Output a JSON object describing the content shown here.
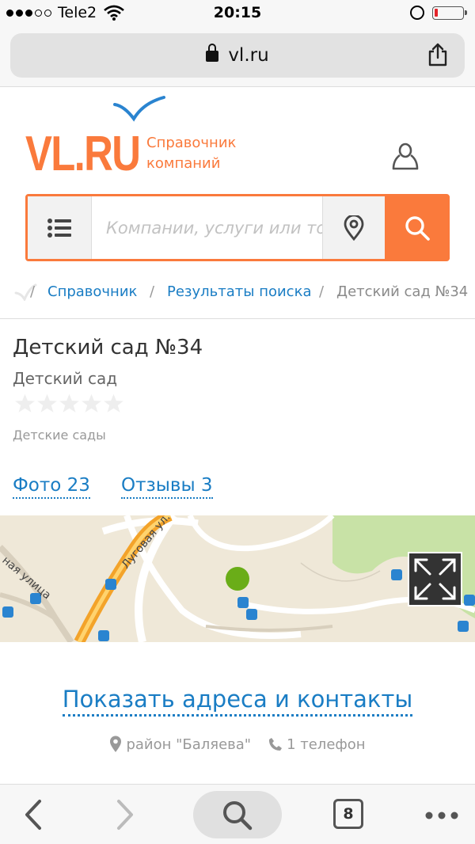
{
  "status_bar": {
    "carrier": "Tele2",
    "time": "20:15",
    "signal_bars_filled": 3,
    "signal_bars_total": 5,
    "battery_fraction": 0.12
  },
  "browser": {
    "url": "vl.ru",
    "open_tabs_count": "8"
  },
  "header": {
    "logo_text": "VL.RU",
    "tagline_line1": "Справочник",
    "tagline_line2": "компаний",
    "accent_color": "#fa7a3c",
    "link_color": "#1a7dc4"
  },
  "search": {
    "placeholder": "Компании, услуги или товары"
  },
  "breadcrumb": {
    "items": [
      "Справочник",
      "Результаты поиска"
    ],
    "current": "Детский сад №34",
    "separator": "/"
  },
  "company": {
    "name": "Детский сад №34",
    "type": "Детский сад",
    "rating_value": 0,
    "rating_max": 5,
    "category": "Детские сады"
  },
  "tabs": {
    "photos": "Фото 23",
    "reviews": "Отзывы 3"
  },
  "map": {
    "street_1": "Луговая ул.",
    "street_2": "ная улица"
  },
  "contacts": {
    "show_link": "Показать адреса и контакты",
    "district": "район \"Баляева\"",
    "phones": "1 телефон"
  }
}
